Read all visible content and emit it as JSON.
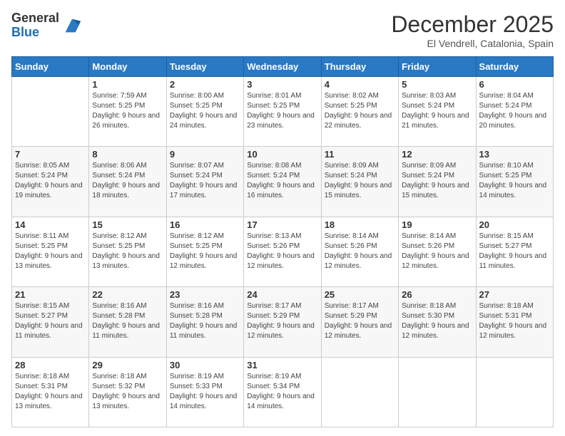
{
  "header": {
    "logo_general": "General",
    "logo_blue": "Blue",
    "month_title": "December 2025",
    "subtitle": "El Vendrell, Catalonia, Spain"
  },
  "days_of_week": [
    "Sunday",
    "Monday",
    "Tuesday",
    "Wednesday",
    "Thursday",
    "Friday",
    "Saturday"
  ],
  "weeks": [
    [
      {
        "day": "",
        "sunrise": "",
        "sunset": "",
        "daylight": ""
      },
      {
        "day": "1",
        "sunrise": "Sunrise: 7:59 AM",
        "sunset": "Sunset: 5:25 PM",
        "daylight": "Daylight: 9 hours and 26 minutes."
      },
      {
        "day": "2",
        "sunrise": "Sunrise: 8:00 AM",
        "sunset": "Sunset: 5:25 PM",
        "daylight": "Daylight: 9 hours and 24 minutes."
      },
      {
        "day": "3",
        "sunrise": "Sunrise: 8:01 AM",
        "sunset": "Sunset: 5:25 PM",
        "daylight": "Daylight: 9 hours and 23 minutes."
      },
      {
        "day": "4",
        "sunrise": "Sunrise: 8:02 AM",
        "sunset": "Sunset: 5:25 PM",
        "daylight": "Daylight: 9 hours and 22 minutes."
      },
      {
        "day": "5",
        "sunrise": "Sunrise: 8:03 AM",
        "sunset": "Sunset: 5:24 PM",
        "daylight": "Daylight: 9 hours and 21 minutes."
      },
      {
        "day": "6",
        "sunrise": "Sunrise: 8:04 AM",
        "sunset": "Sunset: 5:24 PM",
        "daylight": "Daylight: 9 hours and 20 minutes."
      }
    ],
    [
      {
        "day": "7",
        "sunrise": "Sunrise: 8:05 AM",
        "sunset": "Sunset: 5:24 PM",
        "daylight": "Daylight: 9 hours and 19 minutes."
      },
      {
        "day": "8",
        "sunrise": "Sunrise: 8:06 AM",
        "sunset": "Sunset: 5:24 PM",
        "daylight": "Daylight: 9 hours and 18 minutes."
      },
      {
        "day": "9",
        "sunrise": "Sunrise: 8:07 AM",
        "sunset": "Sunset: 5:24 PM",
        "daylight": "Daylight: 9 hours and 17 minutes."
      },
      {
        "day": "10",
        "sunrise": "Sunrise: 8:08 AM",
        "sunset": "Sunset: 5:24 PM",
        "daylight": "Daylight: 9 hours and 16 minutes."
      },
      {
        "day": "11",
        "sunrise": "Sunrise: 8:09 AM",
        "sunset": "Sunset: 5:24 PM",
        "daylight": "Daylight: 9 hours and 15 minutes."
      },
      {
        "day": "12",
        "sunrise": "Sunrise: 8:09 AM",
        "sunset": "Sunset: 5:24 PM",
        "daylight": "Daylight: 9 hours and 15 minutes."
      },
      {
        "day": "13",
        "sunrise": "Sunrise: 8:10 AM",
        "sunset": "Sunset: 5:25 PM",
        "daylight": "Daylight: 9 hours and 14 minutes."
      }
    ],
    [
      {
        "day": "14",
        "sunrise": "Sunrise: 8:11 AM",
        "sunset": "Sunset: 5:25 PM",
        "daylight": "Daylight: 9 hours and 13 minutes."
      },
      {
        "day": "15",
        "sunrise": "Sunrise: 8:12 AM",
        "sunset": "Sunset: 5:25 PM",
        "daylight": "Daylight: 9 hours and 13 minutes."
      },
      {
        "day": "16",
        "sunrise": "Sunrise: 8:12 AM",
        "sunset": "Sunset: 5:25 PM",
        "daylight": "Daylight: 9 hours and 12 minutes."
      },
      {
        "day": "17",
        "sunrise": "Sunrise: 8:13 AM",
        "sunset": "Sunset: 5:26 PM",
        "daylight": "Daylight: 9 hours and 12 minutes."
      },
      {
        "day": "18",
        "sunrise": "Sunrise: 8:14 AM",
        "sunset": "Sunset: 5:26 PM",
        "daylight": "Daylight: 9 hours and 12 minutes."
      },
      {
        "day": "19",
        "sunrise": "Sunrise: 8:14 AM",
        "sunset": "Sunset: 5:26 PM",
        "daylight": "Daylight: 9 hours and 12 minutes."
      },
      {
        "day": "20",
        "sunrise": "Sunrise: 8:15 AM",
        "sunset": "Sunset: 5:27 PM",
        "daylight": "Daylight: 9 hours and 11 minutes."
      }
    ],
    [
      {
        "day": "21",
        "sunrise": "Sunrise: 8:15 AM",
        "sunset": "Sunset: 5:27 PM",
        "daylight": "Daylight: 9 hours and 11 minutes."
      },
      {
        "day": "22",
        "sunrise": "Sunrise: 8:16 AM",
        "sunset": "Sunset: 5:28 PM",
        "daylight": "Daylight: 9 hours and 11 minutes."
      },
      {
        "day": "23",
        "sunrise": "Sunrise: 8:16 AM",
        "sunset": "Sunset: 5:28 PM",
        "daylight": "Daylight: 9 hours and 11 minutes."
      },
      {
        "day": "24",
        "sunrise": "Sunrise: 8:17 AM",
        "sunset": "Sunset: 5:29 PM",
        "daylight": "Daylight: 9 hours and 12 minutes."
      },
      {
        "day": "25",
        "sunrise": "Sunrise: 8:17 AM",
        "sunset": "Sunset: 5:29 PM",
        "daylight": "Daylight: 9 hours and 12 minutes."
      },
      {
        "day": "26",
        "sunrise": "Sunrise: 8:18 AM",
        "sunset": "Sunset: 5:30 PM",
        "daylight": "Daylight: 9 hours and 12 minutes."
      },
      {
        "day": "27",
        "sunrise": "Sunrise: 8:18 AM",
        "sunset": "Sunset: 5:31 PM",
        "daylight": "Daylight: 9 hours and 12 minutes."
      }
    ],
    [
      {
        "day": "28",
        "sunrise": "Sunrise: 8:18 AM",
        "sunset": "Sunset: 5:31 PM",
        "daylight": "Daylight: 9 hours and 13 minutes."
      },
      {
        "day": "29",
        "sunrise": "Sunrise: 8:18 AM",
        "sunset": "Sunset: 5:32 PM",
        "daylight": "Daylight: 9 hours and 13 minutes."
      },
      {
        "day": "30",
        "sunrise": "Sunrise: 8:19 AM",
        "sunset": "Sunset: 5:33 PM",
        "daylight": "Daylight: 9 hours and 14 minutes."
      },
      {
        "day": "31",
        "sunrise": "Sunrise: 8:19 AM",
        "sunset": "Sunset: 5:34 PM",
        "daylight": "Daylight: 9 hours and 14 minutes."
      },
      {
        "day": "",
        "sunrise": "",
        "sunset": "",
        "daylight": ""
      },
      {
        "day": "",
        "sunrise": "",
        "sunset": "",
        "daylight": ""
      },
      {
        "day": "",
        "sunrise": "",
        "sunset": "",
        "daylight": ""
      }
    ]
  ]
}
